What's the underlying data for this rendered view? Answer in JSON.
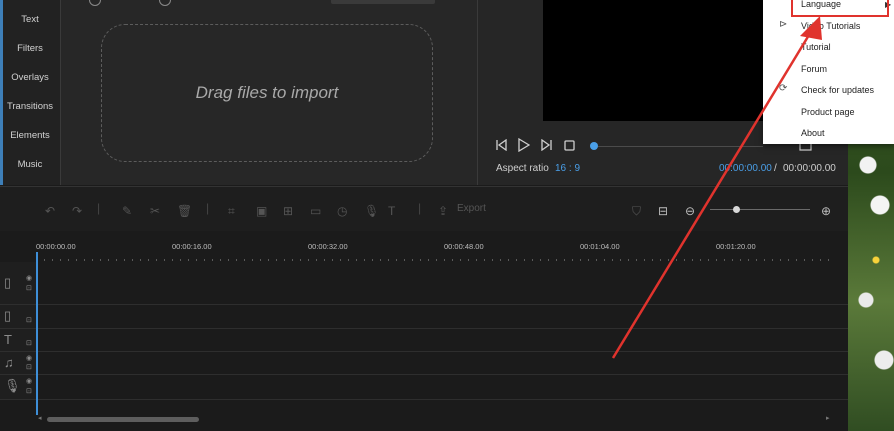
{
  "sidebar": {
    "items": [
      {
        "label": "Text"
      },
      {
        "label": "Filters"
      },
      {
        "label": "Overlays"
      },
      {
        "label": "Transitions"
      },
      {
        "label": "Elements"
      },
      {
        "label": "Music"
      }
    ]
  },
  "import_panel": {
    "drop_text": "Drag files to import"
  },
  "preview": {
    "aspect_label": "Aspect ratio",
    "aspect_value": "16 : 9",
    "time_current": "00:00:00.00",
    "time_separator": "/",
    "time_total": "00:00:00.00",
    "progress": 0
  },
  "toolbar": {
    "export_label": "Export",
    "zoom_level": 0.25
  },
  "timeline": {
    "ruler_labels": [
      "00:00:00.00",
      "00:00:16.00",
      "00:00:32.00",
      "00:00:48.00",
      "00:01:04.00",
      "00:01:20.00"
    ],
    "tracks": [
      {
        "icon": "film-strip-icon"
      },
      {
        "icon": "overlay-icon"
      },
      {
        "icon": "text-icon"
      },
      {
        "icon": "music-note-icon"
      },
      {
        "icon": "microphone-icon"
      }
    ]
  },
  "help_menu": {
    "items": [
      {
        "label": "Language",
        "icon": ""
      },
      {
        "label": "Video Tutorials",
        "icon": "play-circle-icon"
      },
      {
        "label": "Tutorial",
        "icon": ""
      },
      {
        "label": "Forum",
        "icon": ""
      },
      {
        "label": "Check for updates",
        "icon": "refresh-icon"
      },
      {
        "label": "Product page",
        "icon": ""
      },
      {
        "label": "About",
        "icon": ""
      }
    ]
  },
  "colors": {
    "accent": "#4a9fe8",
    "highlight": "#e0332d",
    "background": "#1b1b1b"
  }
}
